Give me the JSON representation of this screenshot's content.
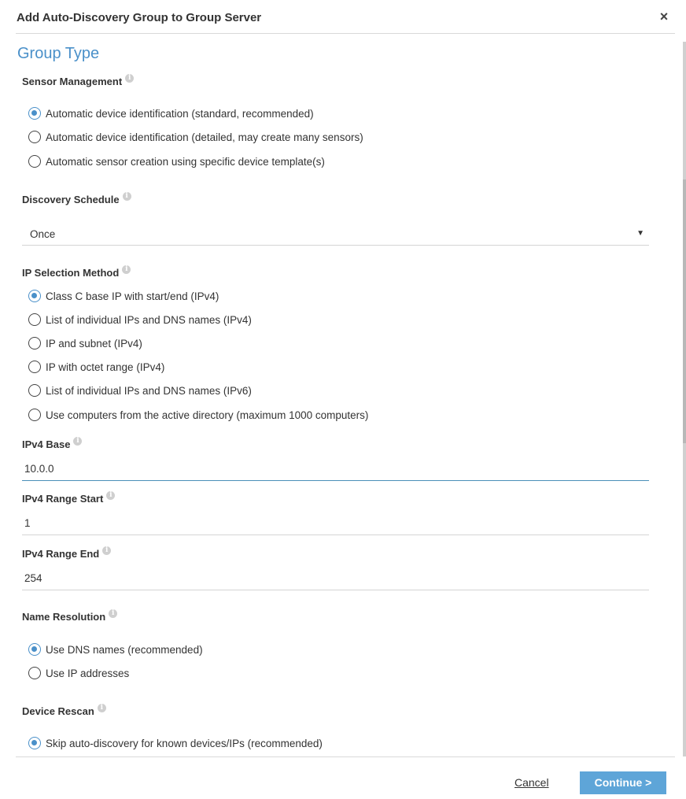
{
  "dialog": {
    "title": "Add Auto-Discovery Group to Group Server",
    "close_icon": "×"
  },
  "section_title": "Group Type",
  "sensor_management": {
    "label": "Sensor Management",
    "options": [
      {
        "label": "Automatic device identification (standard, recommended)",
        "checked": true
      },
      {
        "label": "Automatic device identification (detailed, may create many sensors)",
        "checked": false
      },
      {
        "label": "Automatic sensor creation using specific device template(s)",
        "checked": false
      }
    ]
  },
  "discovery_schedule": {
    "label": "Discovery Schedule",
    "value": "Once",
    "arrow": "▼"
  },
  "ip_selection": {
    "label": "IP Selection Method",
    "options": [
      {
        "label": "Class C base IP with start/end (IPv4)",
        "checked": true
      },
      {
        "label": "List of individual IPs and DNS names (IPv4)",
        "checked": false
      },
      {
        "label": "IP and subnet (IPv4)",
        "checked": false
      },
      {
        "label": "IP with octet range (IPv4)",
        "checked": false
      },
      {
        "label": "List of individual IPs and DNS names (IPv6)",
        "checked": false
      },
      {
        "label": "Use computers from the active directory (maximum 1000 computers)",
        "checked": false
      }
    ]
  },
  "ipv4_base": {
    "label": "IPv4 Base",
    "value": "10.0.0"
  },
  "ipv4_range_start": {
    "label": "IPv4 Range Start",
    "value": "1"
  },
  "ipv4_range_end": {
    "label": "IPv4 Range End",
    "value": "254"
  },
  "name_resolution": {
    "label": "Name Resolution",
    "options": [
      {
        "label": "Use DNS names (recommended)",
        "checked": true
      },
      {
        "label": "Use IP addresses",
        "checked": false
      }
    ]
  },
  "device_rescan": {
    "label": "Device Rescan",
    "options": [
      {
        "label": "Skip auto-discovery for known devices/IPs (recommended)",
        "checked": true
      }
    ]
  },
  "info_icon": "i",
  "footer": {
    "cancel_label": "Cancel",
    "continue_label": "Continue >"
  },
  "colors": {
    "accent": "#4a90c9",
    "button": "#5ea5d8"
  }
}
